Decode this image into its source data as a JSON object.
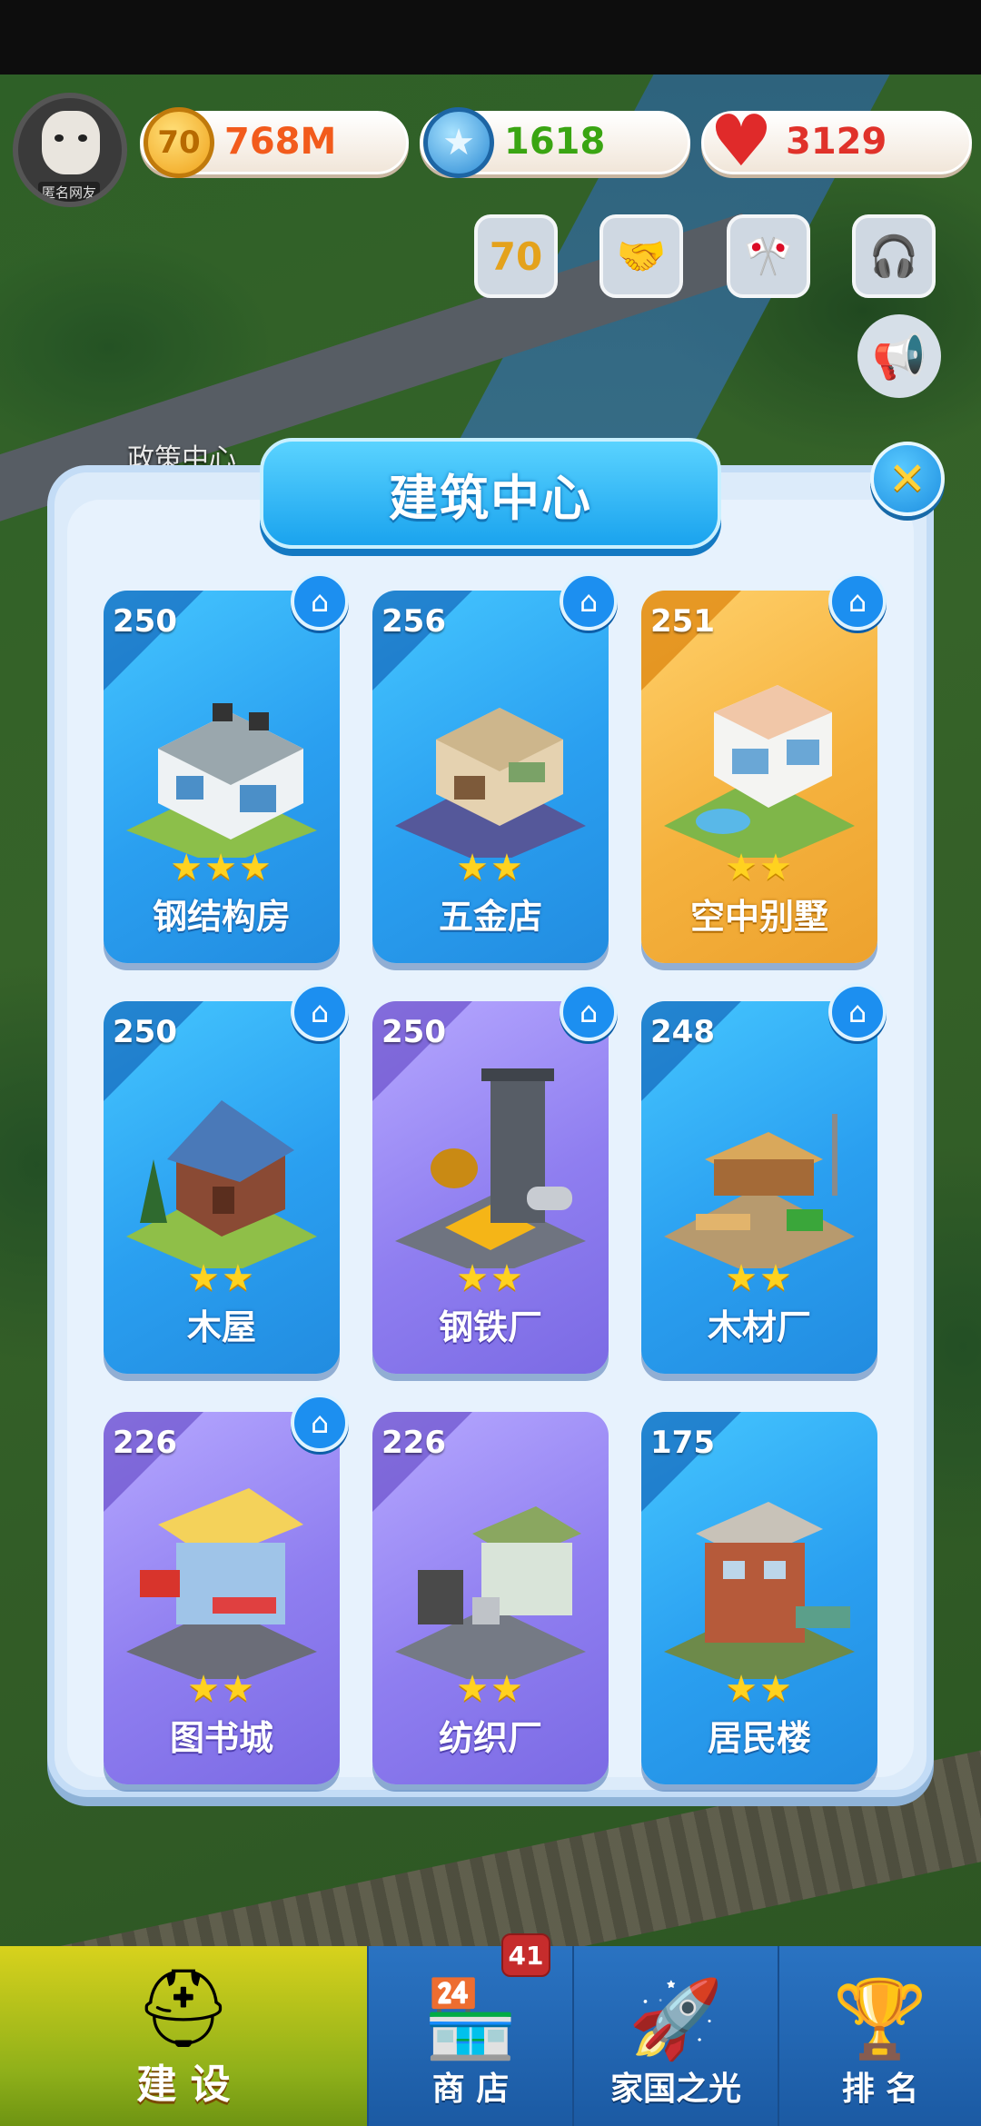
{
  "currencies": {
    "coins": {
      "icon": "coin-icon",
      "glyph": "70",
      "value": "768M",
      "color": "#f25b1c"
    },
    "gems": {
      "icon": "star-gem-icon",
      "value": "1618",
      "color": "#3aa512"
    },
    "hearts": {
      "icon": "heart-icon",
      "value": "3129",
      "color": "#e0322a"
    }
  },
  "avatar": {
    "tag": "匿名网友"
  },
  "map": {
    "policy_center_label": "政策中心"
  },
  "events": {
    "anniversary": {
      "glyph": "70"
    }
  },
  "panel": {
    "title": "建筑中心",
    "close_glyph": "✕",
    "buildings": [
      {
        "level": "250",
        "name": "钢结构房",
        "stars": 3,
        "theme": "blue",
        "home_badge": true
      },
      {
        "level": "256",
        "name": "五金店",
        "stars": 2,
        "theme": "blue",
        "home_badge": true
      },
      {
        "level": "251",
        "name": "空中别墅",
        "stars": 2,
        "theme": "gold",
        "home_badge": true
      },
      {
        "level": "250",
        "name": "木屋",
        "stars": 2,
        "theme": "blue",
        "home_badge": true
      },
      {
        "level": "250",
        "name": "钢铁厂",
        "stars": 2,
        "theme": "purple",
        "home_badge": true
      },
      {
        "level": "248",
        "name": "木材厂",
        "stars": 2,
        "theme": "blue",
        "home_badge": true
      },
      {
        "level": "226",
        "name": "图书城",
        "stars": 2,
        "theme": "purple",
        "home_badge": true
      },
      {
        "level": "226",
        "name": "纺织厂",
        "stars": 2,
        "theme": "purple",
        "home_badge": false
      },
      {
        "level": "175",
        "name": "居民楼",
        "stars": 2,
        "theme": "blue",
        "home_badge": false
      }
    ]
  },
  "bottom_nav": {
    "build": {
      "label": "建 设",
      "icon": "hard-hat-icon"
    },
    "shop": {
      "label": "商 店",
      "icon": "shop-icon",
      "badge": "41"
    },
    "home_glory": {
      "label": "家国之光",
      "icon": "rocket-icon"
    },
    "ranking": {
      "label": "排 名",
      "icon": "ranking-icon"
    }
  }
}
